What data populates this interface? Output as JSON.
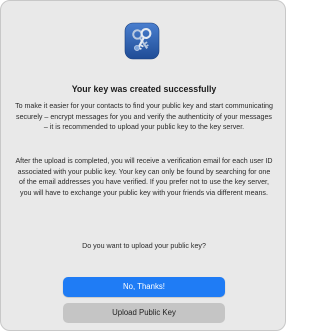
{
  "dialog": {
    "app_icon": "gpg-keychain-keys-icon",
    "title": "Your key was created successfully",
    "paragraph_1": "To make it easier for your contacts to find your public key and start communicating securely – encrypt messages for you and verify the authenticity of your messages – it is recommended to upload your public key to the key server.",
    "paragraph_2": "After the upload is completed, you will receive a verification email for each user ID associated with your public key. Your key can only be found by searching for one of the email addresses you have verified. If you prefer not to use the key server, you will have to exchange your public key with your friends via different means.",
    "question": "Do you want to upload your public key?",
    "primary_button_label": "No, Thanks!",
    "secondary_button_label": "Upload Public Key"
  },
  "colors": {
    "dialog_background": "#e9e9e9",
    "primary_button": "#1f7cf5",
    "secondary_button": "#c5c5c5",
    "icon_background": "#2f5fae"
  }
}
